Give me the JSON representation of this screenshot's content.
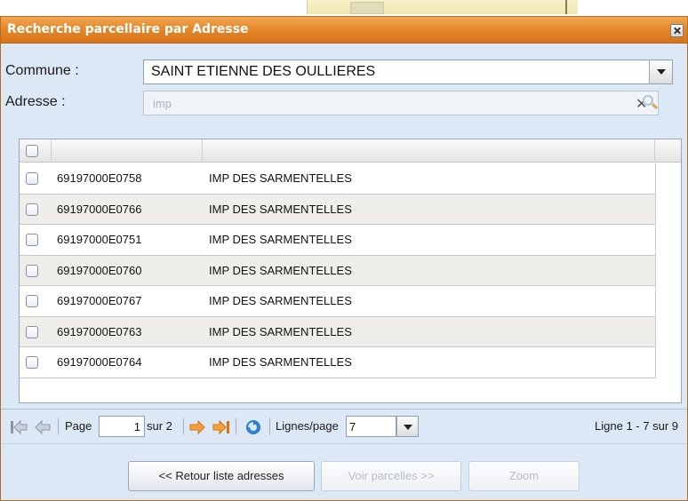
{
  "window": {
    "title": "Recherche parcellaire par Adresse"
  },
  "form": {
    "commune_label": "Commune :",
    "commune_value": "SAINT ETIENNE DES OULLIERES",
    "adresse_label": "Adresse :",
    "adresse_value": "imp"
  },
  "grid": {
    "rows": [
      {
        "parcel": "69197000E0758",
        "address": "IMP DES SARMENTELLES"
      },
      {
        "parcel": "69197000E0766",
        "address": "IMP DES SARMENTELLES"
      },
      {
        "parcel": "69197000E0751",
        "address": "IMP DES SARMENTELLES"
      },
      {
        "parcel": "69197000E0760",
        "address": "IMP DES SARMENTELLES"
      },
      {
        "parcel": "69197000E0767",
        "address": "IMP DES SARMENTELLES"
      },
      {
        "parcel": "69197000E0763",
        "address": "IMP DES SARMENTELLES"
      },
      {
        "parcel": "69197000E0764",
        "address": "IMP DES SARMENTELLES"
      }
    ]
  },
  "pager": {
    "page_label": "Page",
    "page_value": "1",
    "of_label": "sur 2",
    "lines_label": "Lignes/page",
    "lines_value": "7",
    "summary": "Ligne 1 - 7 sur 9"
  },
  "buttons": {
    "back": "<< Retour liste adresses",
    "view": "Voir parcelles >>",
    "zoom": "Zoom"
  },
  "icons": {
    "first_page": "first-page-icon",
    "prev_page": "prev-page-icon",
    "next_page": "next-page-icon",
    "last_page": "last-page-icon",
    "refresh": "refresh-icon",
    "clear": "clear-icon",
    "search": "search-icon"
  },
  "colors": {
    "title_bar": "#e48629",
    "panel_bg": "#dce8f6",
    "arrow_accent": "#f08a1c",
    "refresh_accent": "#2a7dd6"
  }
}
